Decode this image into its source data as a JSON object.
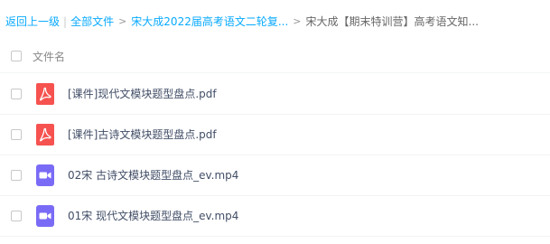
{
  "breadcrumb": {
    "back": "返回上一级",
    "root": "全部文件",
    "folder": "宋大成2022届高考语文二轮复...",
    "current": "宋大成【期末特训营】高考语文知..."
  },
  "list": {
    "column_name": "文件名",
    "files": [
      {
        "name": "[课件]现代文模块题型盘点.pdf",
        "icon": "pdf-icon",
        "color": "#f6524f"
      },
      {
        "name": "[课件]古诗文模块题型盘点.pdf",
        "icon": "pdf-icon",
        "color": "#f6524f"
      },
      {
        "name": "02宋 古诗文模块题型盘点_ev.mp4",
        "icon": "video-icon",
        "color": "#7a6bf6"
      },
      {
        "name": "01宋 现代文模块题型盘点_ev.mp4",
        "icon": "video-icon",
        "color": "#7a6bf6"
      }
    ]
  }
}
